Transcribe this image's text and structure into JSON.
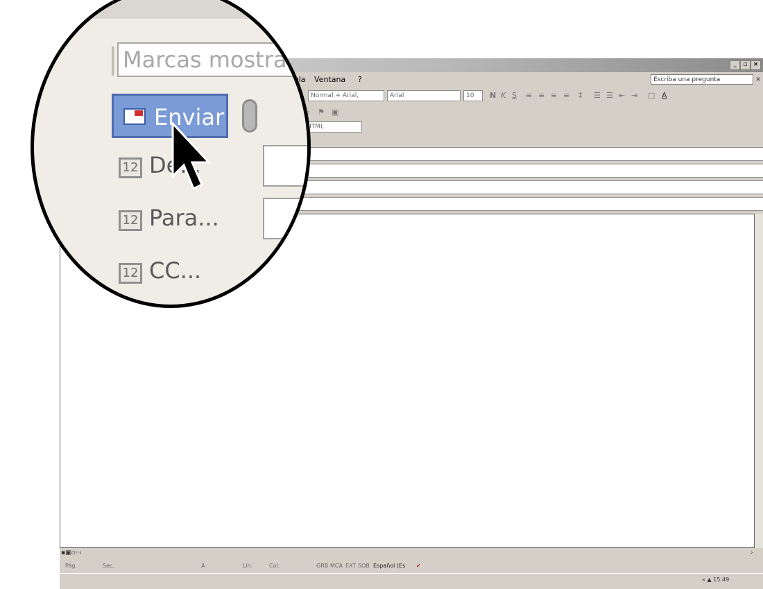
{
  "menubar": {
    "items": [
      "Tabla",
      "Ventana",
      "?"
    ],
    "ask_placeholder": "Escriba una pregunta"
  },
  "toolbar": {
    "style_value": "Normal + Arial,",
    "font_value": "Arial",
    "size_value": "10",
    "format_value": "HTML"
  },
  "magnifier": {
    "marks_value": "Marcas mostradas",
    "send_label": "Enviar",
    "from_label": "De...",
    "to_label": "Para...",
    "cc_label": "CC..."
  },
  "statusbar": {
    "page": "Pág.",
    "section": "Sec.",
    "at": "A",
    "line": "Lín.",
    "col": "Col.",
    "grb": "GRB",
    "mca": "MCA",
    "ext": "EXT",
    "sob": "SOB",
    "language": "Español (Es"
  },
  "taskbar": {
    "clock": "15:49"
  },
  "icons": {
    "send": "envelope-send-icon",
    "attach": "paperclip-icon",
    "address_book": "address-book-icon",
    "cursor": "arrow-cursor-icon"
  },
  "colors": {
    "send_button": "#7b9bd6",
    "window_face": "#d4d0c8"
  }
}
